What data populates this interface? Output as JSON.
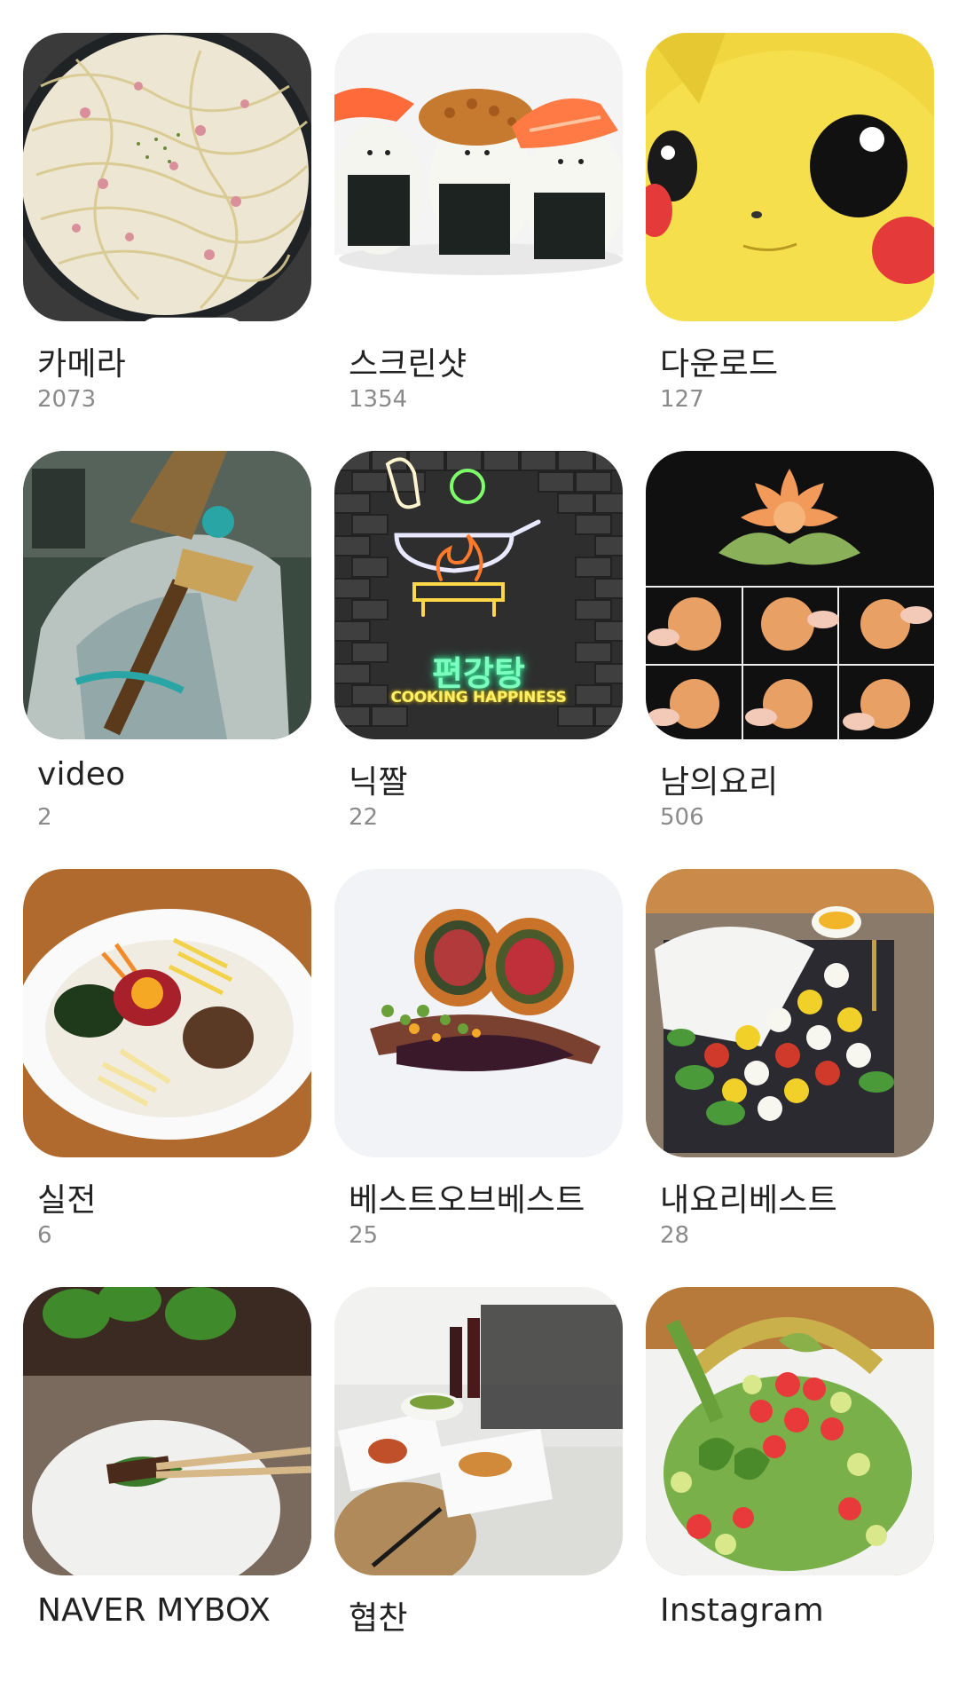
{
  "albums": [
    {
      "name": "카메라",
      "count": "2073",
      "icon": "camera-icon"
    },
    {
      "name": "스크린샷",
      "count": "1354"
    },
    {
      "name": "다운로드",
      "count": "127"
    },
    {
      "name": "video",
      "count": "2"
    },
    {
      "name": "닉짤",
      "count": "22",
      "thumb_text": "편강탕",
      "thumb_subtext": "COOKING HAPPINESS"
    },
    {
      "name": "남의요리",
      "count": "506"
    },
    {
      "name": "실전",
      "count": "6"
    },
    {
      "name": "베스트오브베스트",
      "count": "25"
    },
    {
      "name": "내요리베스트",
      "count": "28"
    },
    {
      "name": "NAVER MYBOX",
      "count": ""
    },
    {
      "name": "협찬",
      "count": ""
    },
    {
      "name": "Instagram",
      "count": ""
    }
  ],
  "colors": {
    "background": "#ffffff",
    "album_name": "#222222",
    "album_count": "#8a8a8a"
  }
}
